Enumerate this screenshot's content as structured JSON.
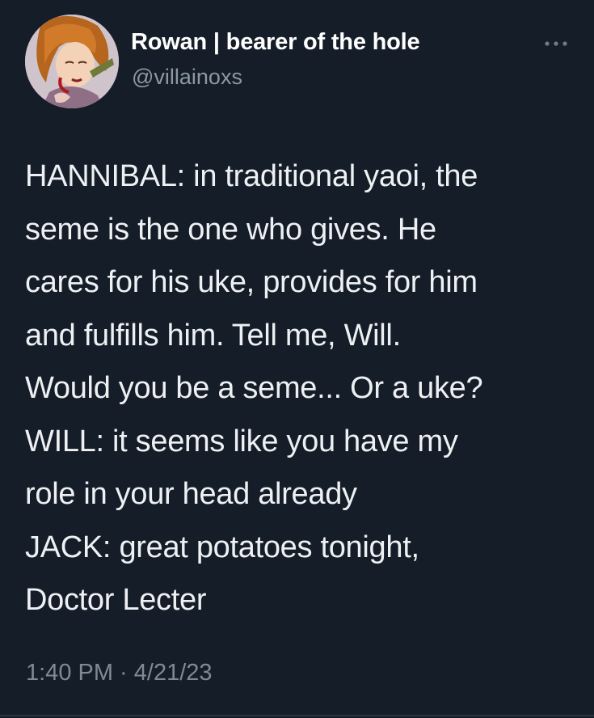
{
  "author": {
    "display_name": "Rowan | bearer of the hole",
    "handle": "@villainoxs",
    "avatar_icon": "profile-avatar-illustration"
  },
  "menu": {
    "icon": "more-horizontal-icon"
  },
  "tweet": {
    "lines": [
      "HANNIBAL: in traditional yaoi, the",
      "seme is the one who gives. He",
      "cares for his uke, provides for him",
      "and fulfills him. Tell me, Will.",
      "Would you be a seme... Or a uke?",
      "WILL: it seems like you have my",
      "role in your head already",
      "JACK: great potatoes tonight,",
      "Doctor Lecter"
    ],
    "timestamp": "1:40 PM · 4/21/23"
  },
  "colors": {
    "background": "#151d28",
    "text_primary": "#eef1f3",
    "text_secondary": "#8b98a5"
  }
}
